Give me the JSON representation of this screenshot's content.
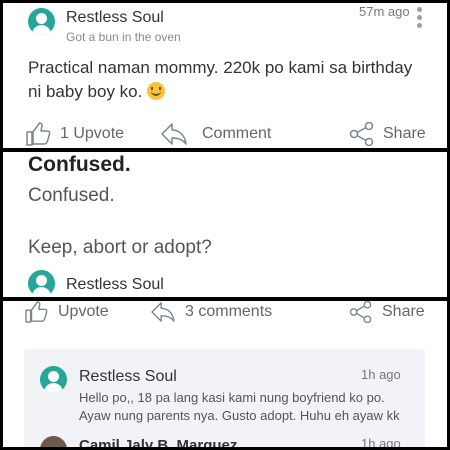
{
  "post": {
    "author": "Restless Soul",
    "subtitle": "Got a bun in the oven",
    "time": "57m ago",
    "body_line1": "Practical naman mommy. 220k po kami sa birthday",
    "body_line2": "ni baby boy ko.",
    "emoji": "smiling-face",
    "upvote_label": "1 Upvote",
    "comment_label": "Comment",
    "share_label": "Share"
  },
  "question": {
    "title": "Confused.",
    "body": "Confused.",
    "body2": "Keep, abort or adopt?",
    "author": "Restless Soul"
  },
  "thread": {
    "upvote_label": "Upvote",
    "comments_label": "3 comments",
    "share_label": "Share",
    "reply": {
      "author": "Restless Soul",
      "time": "1h ago",
      "line1": "Hello po,, 18 pa lang kasi kami nung boyfriend ko po.",
      "line2": "Ayaw nung parents nya. Gusto adopt. Huhu eh ayaw kk"
    },
    "next_reply": {
      "author": "Camil Jaly B. Marquez",
      "time": "1h ago"
    }
  },
  "colors": {
    "avatar": "#26a69a",
    "text": "#333333",
    "muted": "#8a8a8a"
  },
  "icons": [
    "thumbs-up-icon",
    "comment-arrow-icon",
    "share-icon",
    "kebab-menu-icon"
  ]
}
